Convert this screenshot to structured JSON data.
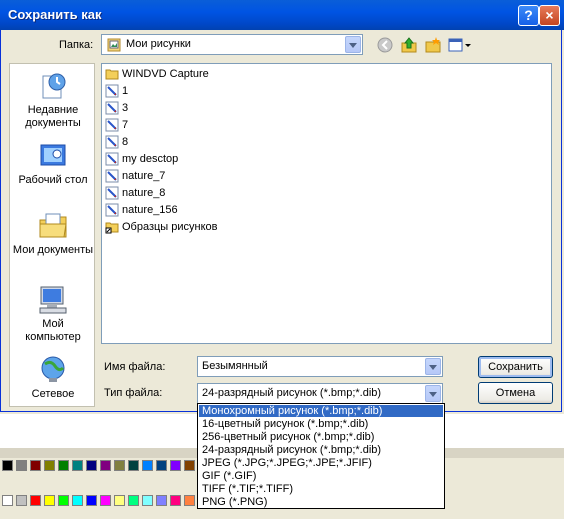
{
  "window": {
    "title": "Сохранить как",
    "help_label": "?",
    "close_label": "×"
  },
  "folder": {
    "label": "Папка:",
    "value": "Мои рисунки"
  },
  "places": [
    {
      "label": "Недавние документы",
      "icon": "recent-documents-icon"
    },
    {
      "label": "Рабочий стол",
      "icon": "desktop-icon"
    },
    {
      "label": "Мои документы",
      "icon": "my-documents-icon"
    },
    {
      "label": "Мой компьютер",
      "icon": "my-computer-icon"
    },
    {
      "label": "Сетевое",
      "icon": "network-icon"
    }
  ],
  "files": [
    {
      "name": "WINDVD Capture",
      "type": "folder"
    },
    {
      "name": "1",
      "type": "image"
    },
    {
      "name": "3",
      "type": "image"
    },
    {
      "name": "7",
      "type": "image"
    },
    {
      "name": "8",
      "type": "image"
    },
    {
      "name": "my desctop",
      "type": "image"
    },
    {
      "name": "nature_7",
      "type": "image"
    },
    {
      "name": "nature_8",
      "type": "image"
    },
    {
      "name": "nature_156",
      "type": "image"
    },
    {
      "name": "Образцы рисунков",
      "type": "shortcut-folder"
    }
  ],
  "filename": {
    "label": "Имя файла:",
    "value": "Безымянный"
  },
  "filetype": {
    "label": "Тип файла:",
    "value": "24-разрядный рисунок (*.bmp;*.dib)",
    "options": [
      "Монохромный рисунок (*.bmp;*.dib)",
      "16-цветный рисунок (*.bmp;*.dib)",
      "256-цветный рисунок (*.bmp;*.dib)",
      "24-разрядный рисунок (*.bmp;*.dib)",
      "JPEG (*.JPG;*.JPEG;*.JPE;*.JFIF)",
      "GIF (*.GIF)",
      "TIFF (*.TIF;*.TIFF)",
      "PNG (*.PNG)"
    ],
    "highlighted_index": 0
  },
  "buttons": {
    "save": "Сохранить",
    "cancel": "Отмена"
  },
  "colors": {
    "titlebar": "#0054e3",
    "highlight": "#316ac5",
    "dialog_bg": "#ece9d8"
  }
}
